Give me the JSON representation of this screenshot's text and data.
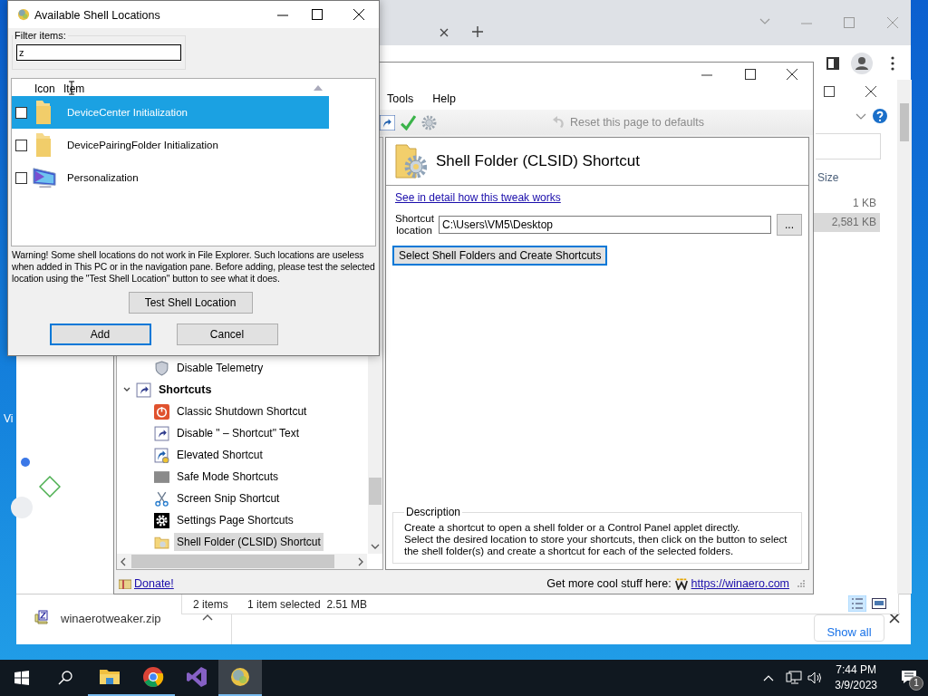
{
  "desktop": {
    "icon_labels": [
      "Vi"
    ]
  },
  "browser": {
    "downloads": [
      {
        "name": "winaerotweaker.zip"
      }
    ],
    "show_all": "Show all"
  },
  "explorer": {
    "column": "Size",
    "rows": [
      {
        "size": "1 KB",
        "selected": false
      },
      {
        "size": "2,581 KB",
        "selected": true
      }
    ],
    "status": [
      "2 items",
      "1 item selected  2.51 MB"
    ]
  },
  "tweaker": {
    "menu": [
      "Tools",
      "Help"
    ],
    "reset": "Reset this page to defaults",
    "tree": [
      {
        "children": [
          {
            "label": "Disable Telemetry",
            "kind": "shield",
            "selected": false
          }
        ]
      },
      {
        "label": "Shortcuts",
        "kind": "shortcut",
        "expanded": true,
        "selected": false,
        "children": [
          {
            "label": "Classic Shutdown Shortcut",
            "kind": "power",
            "selected": false
          },
          {
            "label": "Disable \" – Shortcut\" Text",
            "kind": "shortcut",
            "selected": false
          },
          {
            "label": "Elevated Shortcut",
            "kind": "elevated",
            "selected": false
          },
          {
            "label": "Safe Mode Shortcuts",
            "kind": "safemode",
            "selected": false
          },
          {
            "label": "Screen Snip Shortcut",
            "kind": "scissors",
            "selected": false
          },
          {
            "label": "Settings Page Shortcuts",
            "kind": "gear",
            "selected": false
          },
          {
            "label": "Shell Folder (CLSID) Shortcut",
            "kind": "folder",
            "selected": true
          }
        ]
      }
    ],
    "page_title": "Shell Folder (CLSID) Shortcut",
    "detail_link": "See in detail how this tweak works",
    "location_label": "Shortcut location",
    "location_value": "C:\\Users\\VM5\\Desktop",
    "browse": "...",
    "create_button": "Select Shell Folders and Create Shortcuts",
    "description_title": "Description",
    "description": [
      "Create a shortcut to open a shell folder or a Control Panel applet directly.",
      "Select the desired location to store your shortcuts, then click on the button to select the shell folder(s) and create a shortcut for each of the selected folders."
    ],
    "donate": "Donate!",
    "promo": "Get more cool stuff here:",
    "site": "https://winaero.com"
  },
  "dialog": {
    "title": "Available Shell Locations",
    "filter_label": "Filter items:",
    "filter_value": "z",
    "columns": [
      "Icon",
      "Item"
    ],
    "items": [
      {
        "label": "DeviceCenter Initialization",
        "kind": "folder",
        "checked": false,
        "selected": true
      },
      {
        "label": "DevicePairingFolder Initialization",
        "kind": "folder",
        "checked": false,
        "selected": false
      },
      {
        "label": "Personalization",
        "kind": "monitor",
        "checked": false,
        "selected": false
      }
    ],
    "warning": "Warning! Some shell locations do not work in File Explorer. Such locations are useless when added in This PC or in the navigation pane. Before adding, please test the selected location using the \"Test Shell Location\" button to see what it does.",
    "test_button": "Test Shell Location",
    "buttons": [
      {
        "label": "Add",
        "default": true
      },
      {
        "label": "Cancel",
        "default": false
      }
    ]
  },
  "taskbar": {
    "apps": [
      {
        "kind": "explorer",
        "running": true,
        "selected": false
      },
      {
        "kind": "chrome",
        "running": true,
        "selected": false
      },
      {
        "kind": "studio",
        "running": false,
        "selected": false
      },
      {
        "kind": "tweaker",
        "running": true,
        "selected": true
      }
    ],
    "time": "7:44 PM",
    "date": "3/9/2023",
    "notifications": "1"
  }
}
